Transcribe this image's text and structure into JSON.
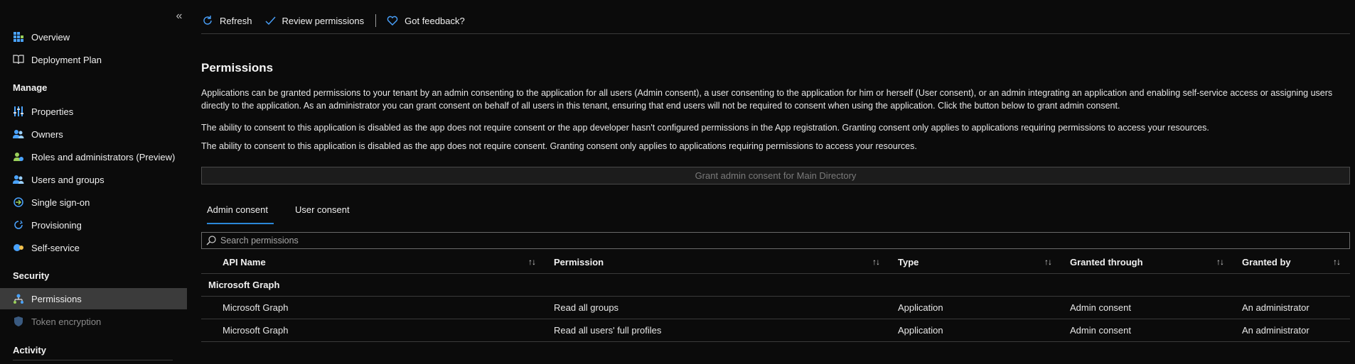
{
  "sidebar": {
    "collapse_label": "«",
    "items_top": [
      {
        "label": "Overview",
        "icon": "overview-icon"
      },
      {
        "label": "Deployment Plan",
        "icon": "book-icon"
      }
    ],
    "manage_header": "Manage",
    "manage_items": [
      {
        "label": "Properties",
        "icon": "properties-icon"
      },
      {
        "label": "Owners",
        "icon": "owners-icon"
      },
      {
        "label": "Roles and administrators (Preview)",
        "icon": "roles-icon"
      },
      {
        "label": "Users and groups",
        "icon": "users-icon"
      },
      {
        "label": "Single sign-on",
        "icon": "sso-icon"
      },
      {
        "label": "Provisioning",
        "icon": "provisioning-icon"
      },
      {
        "label": "Self-service",
        "icon": "self-service-icon"
      }
    ],
    "security_header": "Security",
    "security_items": [
      {
        "label": "Permissions",
        "icon": "permissions-icon",
        "active": true
      },
      {
        "label": "Token encryption",
        "icon": "shield-icon",
        "disabled": true
      }
    ],
    "activity_header": "Activity"
  },
  "toolbar": {
    "refresh_label": "Refresh",
    "review_label": "Review permissions",
    "feedback_label": "Got feedback?"
  },
  "page": {
    "title": "Permissions",
    "para1": "Applications can be granted permissions to your tenant by an admin consenting to the application for all users (Admin consent), a user consenting to the application for him or herself (User consent), or an admin integrating an application and enabling self-service access or assigning users directly to the application. As an administrator you can grant consent on behalf of all users in this tenant, ensuring that end users will not be required to consent when using the application. Click the button below to grant admin consent.",
    "para2": "The ability to consent to this application is disabled as the app does not require consent or the app developer hasn't configured permissions in the App registration. Granting consent only applies to applications requiring permissions to access your resources.",
    "para3": "The ability to consent to this application is disabled as the app does not require consent. Granting consent only applies to applications requiring permissions to access your resources.",
    "grant_button": "Grant admin consent for Main Directory"
  },
  "tabs": {
    "admin": "Admin consent",
    "user": "User consent"
  },
  "search": {
    "placeholder": "Search permissions"
  },
  "table": {
    "columns": [
      "API Name",
      "Permission",
      "Type",
      "Granted through",
      "Granted by"
    ],
    "sort_glyph": "↑↓",
    "group": "Microsoft Graph",
    "rows": [
      {
        "api": "Microsoft Graph",
        "permission": "Read all groups",
        "type": "Application",
        "through": "Admin consent",
        "by": "An administrator"
      },
      {
        "api": "Microsoft Graph",
        "permission": "Read all users' full profiles",
        "type": "Application",
        "through": "Admin consent",
        "by": "An administrator"
      }
    ]
  },
  "colors": {
    "background": "#0b0b0b",
    "active_nav": "#3b3b3b",
    "accent": "#2b88d8"
  }
}
